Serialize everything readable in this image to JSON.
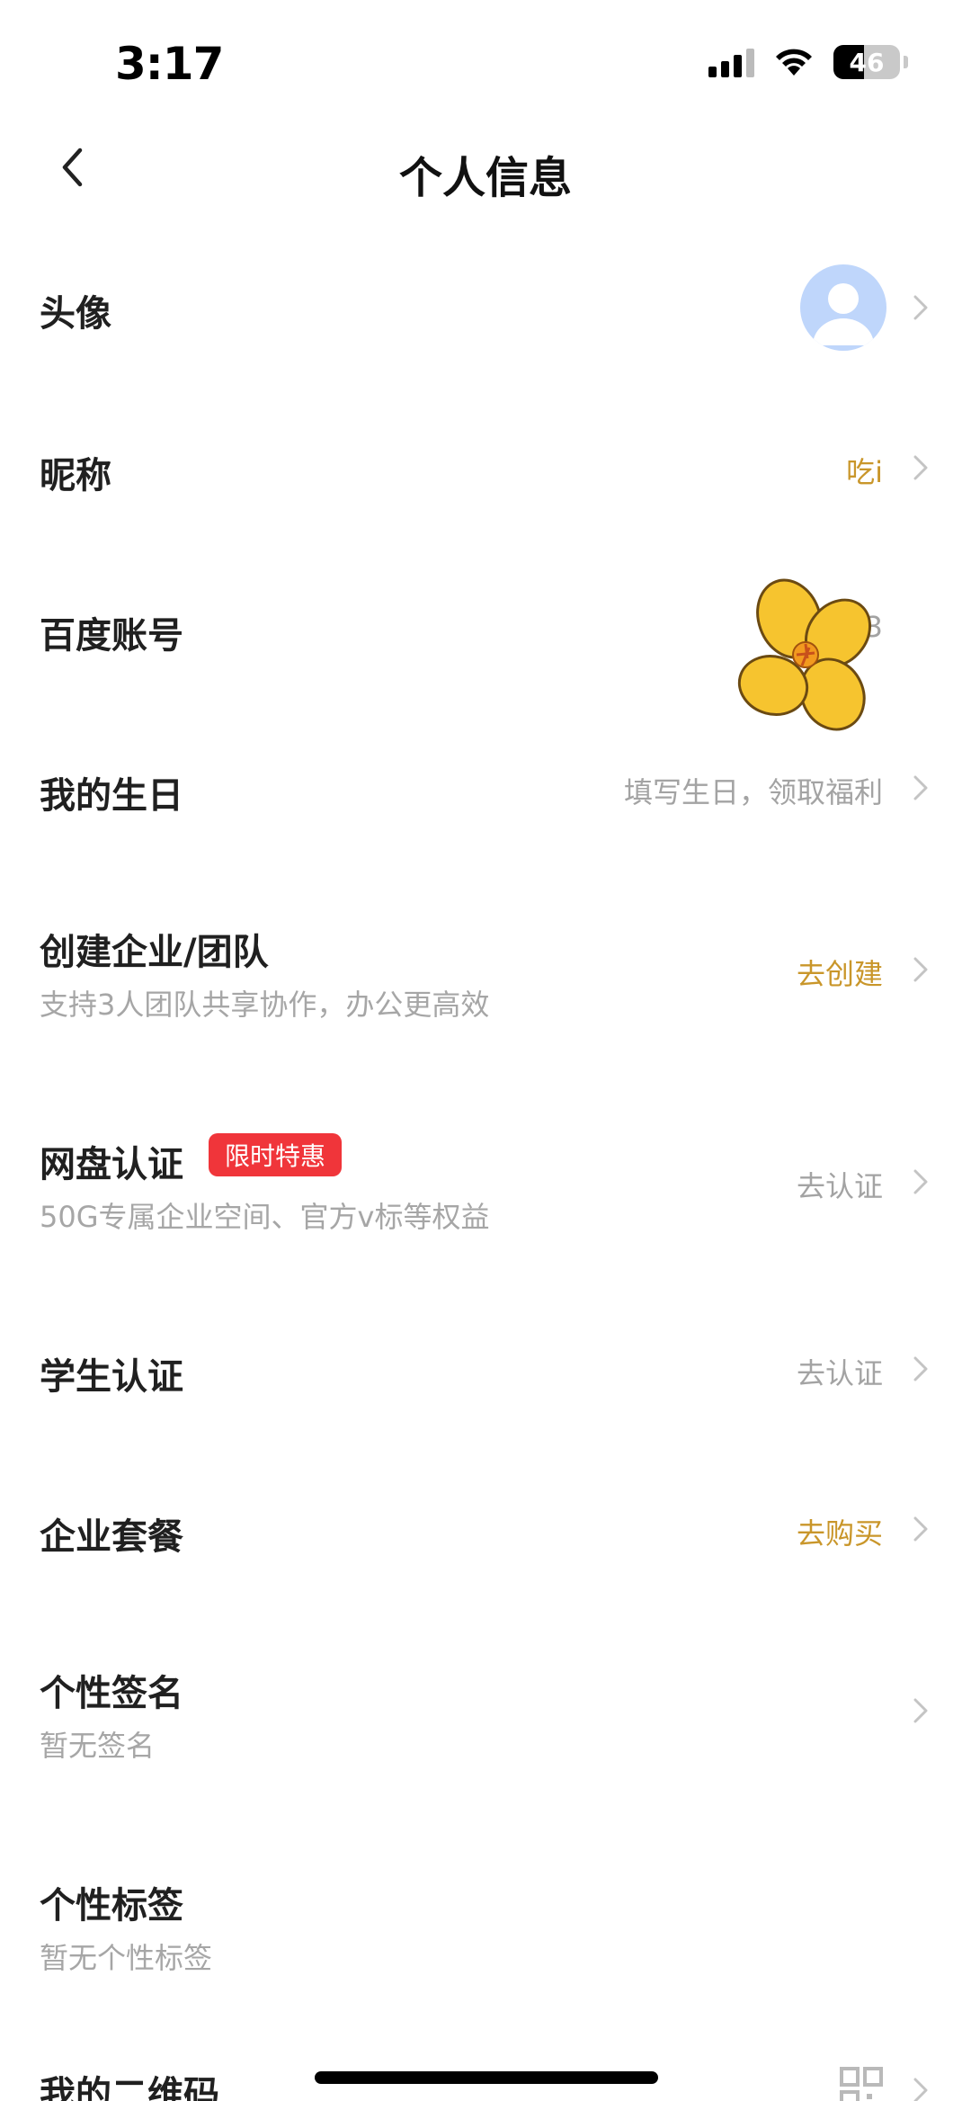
{
  "status_bar": {
    "time": "3:17",
    "battery": "46",
    "battery_level_percent": 46
  },
  "header": {
    "title": "个人信息",
    "back_icon": "chevron-left-icon"
  },
  "rows": {
    "avatar": {
      "label": "头像"
    },
    "nickname": {
      "label": "昵称",
      "value": "吃i"
    },
    "baidu_account": {
      "label": "百度账号",
      "value": "3"
    },
    "birthday": {
      "label": "我的生日",
      "value": "填写生日，领取福利"
    },
    "team": {
      "label": "创建企业/团队",
      "sub": "支持3人团队共享协作，办公更高效",
      "value": "去创建"
    },
    "netdisk_cert": {
      "label": "网盘认证",
      "badge": "限时特惠",
      "sub": "50G专属企业空间、官方v标等权益",
      "value": "去认证"
    },
    "student_cert": {
      "label": "学生认证",
      "value": "去认证"
    },
    "enterprise_plan": {
      "label": "企业套餐",
      "value": "去购买"
    },
    "signature": {
      "label": "个性签名",
      "sub": "暂无签名"
    },
    "tags": {
      "label": "个性标签",
      "sub": "暂无个性标签"
    },
    "qrcode": {
      "label": "我的二维码"
    }
  },
  "colors": {
    "accent_gold": "#c9962a",
    "badge_red": "#f0353a",
    "muted_text": "#a3a3a3"
  }
}
